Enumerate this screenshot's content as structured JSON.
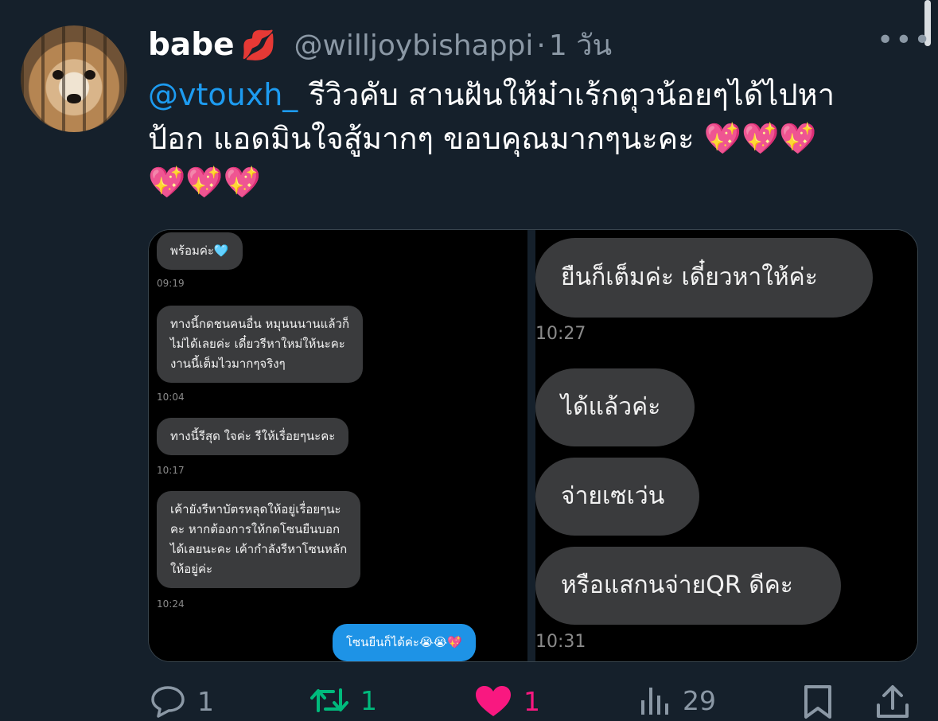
{
  "post": {
    "display_name": "babe",
    "name_emoji": "💋",
    "handle": "@willjoybishappi",
    "separator": "·",
    "time_ago": "1 วัน",
    "more_label": "•••",
    "mention": "@vtouxh_",
    "text_line1": "รีวิวคับ สานฝันให้ม๋าเร้กตุวน้อยๆได้ไปหา",
    "text_line2": "ป้อก แอดมินใจสู้มากๆ ขอบคุณมากๆนะคะ",
    "hearts_line2": "💖💖💖",
    "hearts_line3": "💖💖💖"
  },
  "chat_left": {
    "messages": [
      {
        "text": "พร้อมค่ะ🩵",
        "time": "09:19"
      },
      {
        "text_lines": [
          "ทางนี้กดชนคนอื่น หมุนนนานแล้วก็",
          "ไม่ได้เลยค่ะ เดี๋ยวรีหาใหม่ให้นะคะ",
          "งานนี้เต็มไวมากๆจริงๆ"
        ],
        "time": "10:04"
      },
      {
        "text": "ทางนี้รีสุด ใจค่ะ รีให้เรื่อยๆนะคะ",
        "time": "10:17"
      },
      {
        "text_lines": [
          "เค้ายังรีหาบัตรหลุดให้อยู่เรื่อยๆนะ",
          "คะ หากต้องการให้กดโซนยืนบอก",
          "ได้เลยนะคะ เค้ากำลังรีหาโซนหลัก",
          "ให้อยู่ค่ะ"
        ],
        "time": "10:24"
      },
      {
        "text": "โซนยืนก็ได้ค่ะ😭😭💖"
      }
    ]
  },
  "chat_right": {
    "messages": [
      {
        "text": "ยืนก็เต็มค่ะ เดี๋ยวหาให้ค่ะ",
        "time": "10:27"
      },
      {
        "text": "ได้แล้วค่ะ"
      },
      {
        "text": "จ่ายเซเว่น"
      },
      {
        "text": "หรือแสกนจ่ายQR ดีคะ",
        "time": "10:31"
      }
    ]
  },
  "actions": {
    "reply_count": "1",
    "retweet_count": "1",
    "like_count": "1",
    "views_count": "29"
  },
  "colors": {
    "background": "#15202b",
    "mention": "#1d9bf0",
    "secondary_text": "#8b98a5",
    "retweet_green": "#00ba7c",
    "like_pink": "#f91880",
    "own_bubble": "#1e93e6",
    "other_bubble": "#3a3b3d"
  },
  "icons": [
    "reply-icon",
    "retweet-icon",
    "like-icon",
    "views-icon",
    "bookmark-icon",
    "share-icon",
    "more-icon"
  ]
}
